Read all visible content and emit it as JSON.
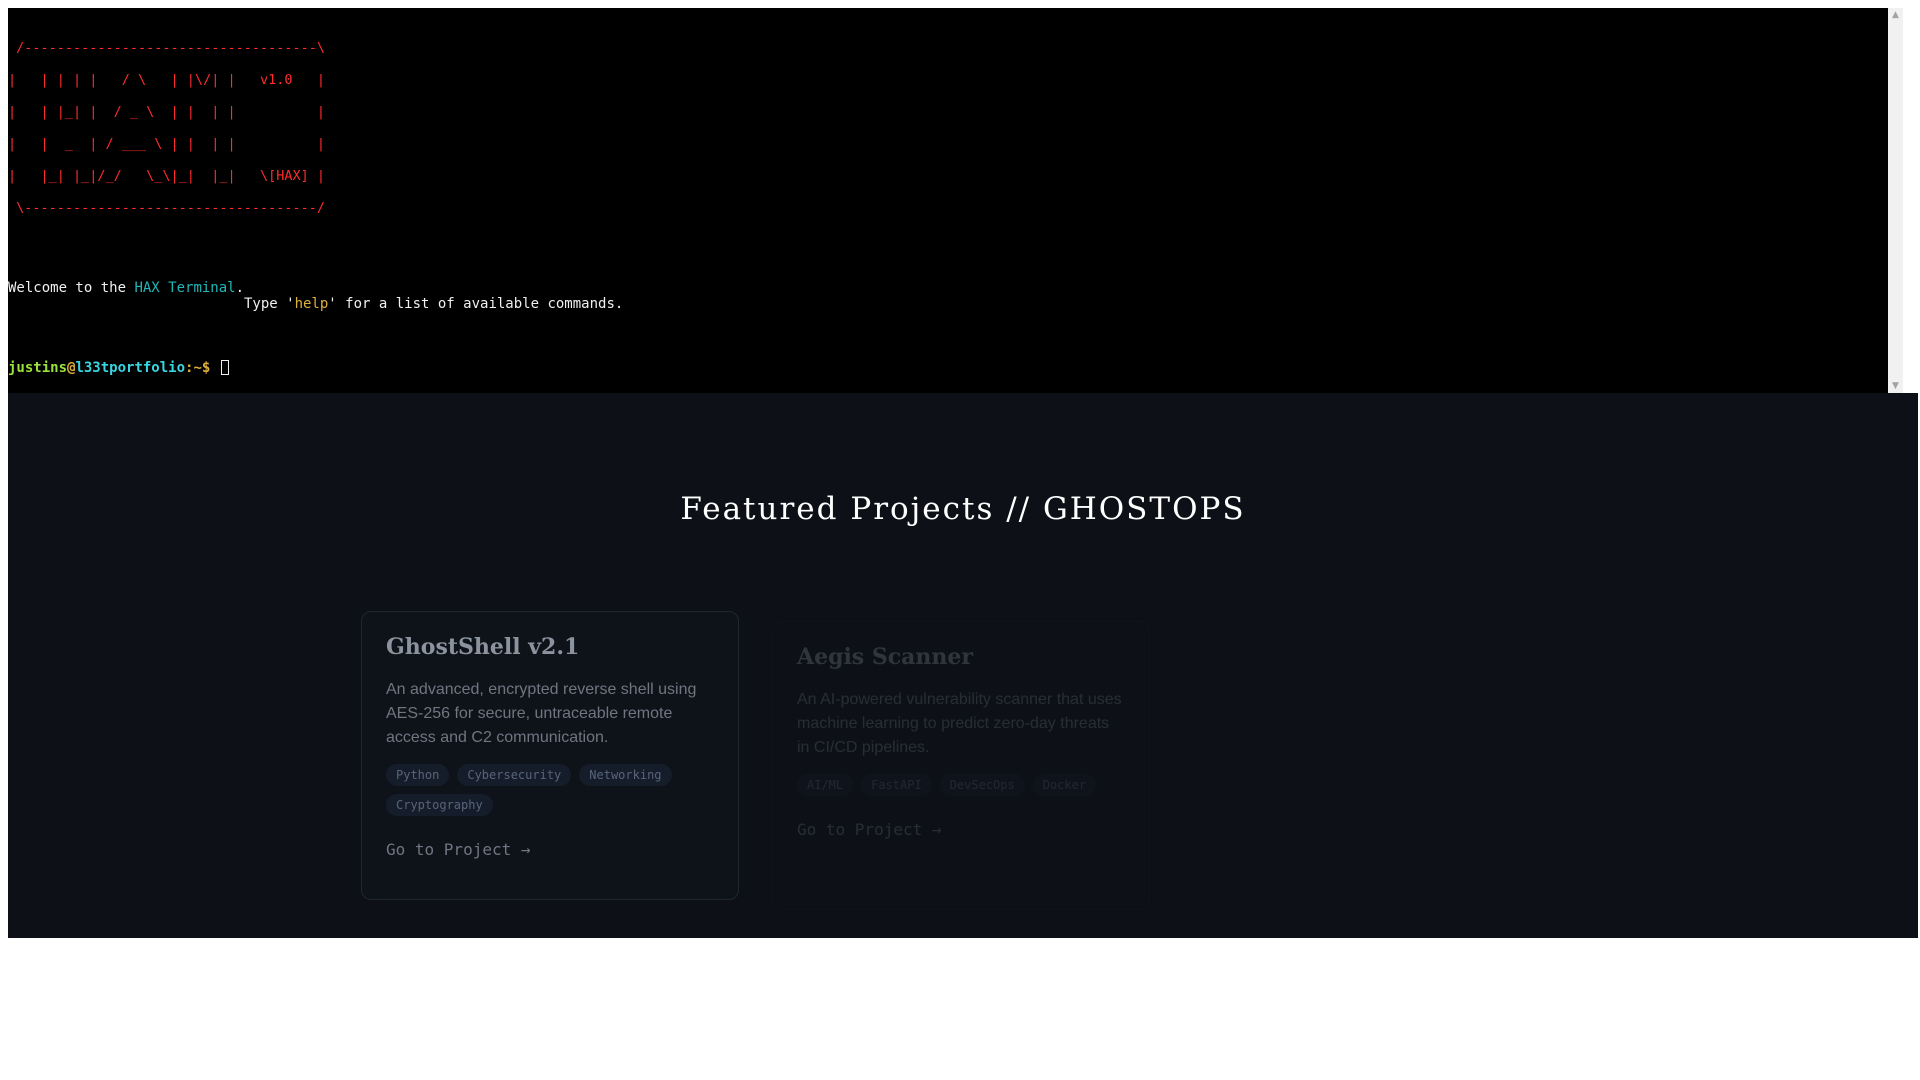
{
  "terminal": {
    "ascii_banner": " /------------------------------------\\\n|   | | | |   / \\   | |\\/| |   v1.0   |\n|   | |_| |  / _ \\  | |  | |          |\n|   |  _  | / ___ \\ | |  | |          |\n|   |_| |_|/_/   \\_\\|_|  |_|   \\[HAX] |\n \\------------------------------------/",
    "welcome_prefix": "Welcome to the ",
    "welcome_accent": "HAX Terminal",
    "welcome_suffix": ".",
    "help_prefix": "Type '",
    "help_cmd": "help",
    "help_suffix": "' for a list of available commands.",
    "prompt": {
      "user": "justins",
      "at": "@",
      "host": "l33tportfolio",
      "path": ":~$"
    }
  },
  "projects": {
    "title": "Featured Projects // GHOSTOPS",
    "cards": [
      {
        "title": "GhostShell v2.1",
        "description": "An advanced, encrypted reverse shell using AES-256 for secure, untraceable remote access and C2 communication.",
        "tags": [
          "Python",
          "Cybersecurity",
          "Networking",
          "Cryptography"
        ],
        "link": "Go to Project →"
      },
      {
        "title": "Aegis Scanner",
        "description": "An AI-powered vulnerability scanner that uses machine learning to predict zero-day threats in CI/CD pipelines.",
        "tags": [
          "AI/ML",
          "FastAPI",
          "DevSecOps",
          "Docker"
        ],
        "link": "Go to Project →"
      }
    ]
  },
  "icons": {
    "scroll_up": "scroll-up-arrow-icon",
    "scroll_down": "scroll-down-arrow-icon"
  },
  "colors": {
    "terminal_bg": "#000000",
    "banner": "#ff2b2b",
    "accent_cyan": "#1fb8b8",
    "accent_yellow": "#e0b13a",
    "prompt_user": "#9be23a",
    "section_bg": "#0d1117"
  }
}
